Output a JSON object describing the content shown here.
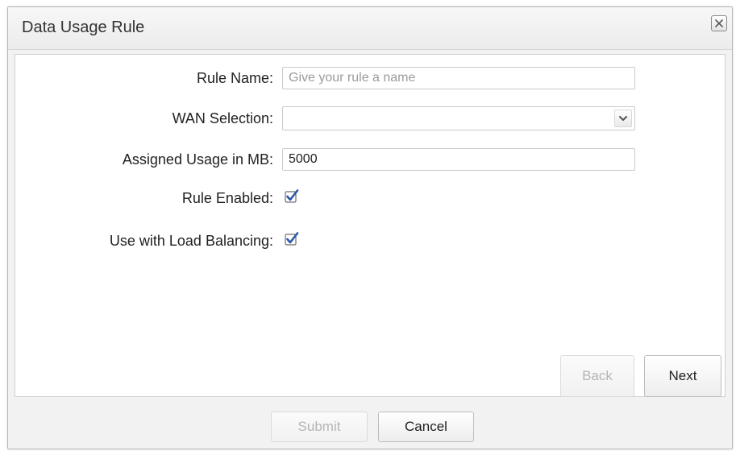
{
  "dialog": {
    "title": "Data Usage Rule",
    "close_label": "close"
  },
  "form": {
    "rule_name": {
      "label": "Rule Name:",
      "value": "",
      "placeholder": "Give your rule a name"
    },
    "wan_selection": {
      "label": "WAN Selection:",
      "selected": ""
    },
    "assigned_usage": {
      "label": "Assigned Usage in MB:",
      "value": "5000"
    },
    "rule_enabled": {
      "label": "Rule Enabled:",
      "checked": true
    },
    "load_balancing": {
      "label": "Use with Load Balancing:",
      "checked": true
    }
  },
  "wizard_nav": {
    "back_label": "Back",
    "back_enabled": false,
    "next_label": "Next"
  },
  "footer": {
    "submit_label": "Submit",
    "submit_enabled": false,
    "cancel_label": "Cancel"
  },
  "colors": {
    "checkbox_check": "#2b57a8"
  }
}
